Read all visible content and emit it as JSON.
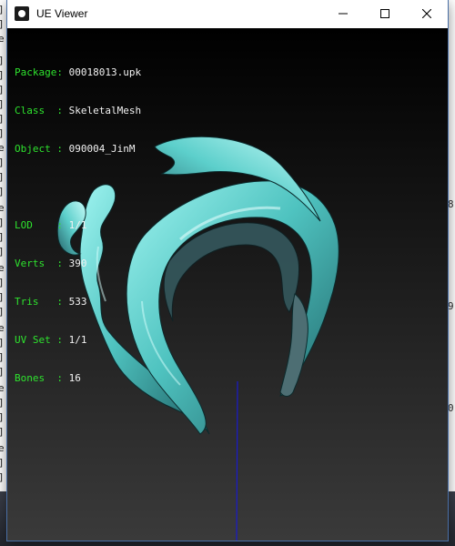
{
  "window": {
    "title": "UE Viewer",
    "controls": {
      "minimize": "—",
      "maximize": "☐",
      "close": "✕"
    }
  },
  "info": {
    "package": {
      "label": "Package:",
      "value": "00018013.upk"
    },
    "class": {
      "label": "Class  :",
      "value": "SkeletalMesh"
    },
    "object": {
      "label": "Object :",
      "value": "090004_JinM"
    },
    "lod": {
      "label": "LOD    :",
      "value": "1/1"
    },
    "verts": {
      "label": "Verts  :",
      "value": "390"
    },
    "tris": {
      "label": "Tris   :",
      "value": "533"
    },
    "uvset": {
      "label": "UV Set :",
      "value": "1/1"
    },
    "bones": {
      "label": "Bones  :",
      "value": "16"
    }
  },
  "colors": {
    "label": "#2ee32e",
    "value": "#f2f2f2",
    "mesh": "#5fd3cf",
    "axis": "#1a1acc"
  },
  "background": {
    "left_chars": [
      "]",
      "]",
      "e",
      "]",
      "]",
      "]",
      "]",
      "]",
      "]",
      "e",
      "]",
      "]",
      "]",
      "e",
      "]",
      "]",
      "]",
      "e",
      "]",
      "]",
      "]",
      "e",
      "]",
      "]",
      "]",
      "e",
      "]",
      "]",
      "]",
      "e",
      "]",
      "]"
    ],
    "right_numbers": [
      "8",
      "9",
      "0"
    ]
  }
}
